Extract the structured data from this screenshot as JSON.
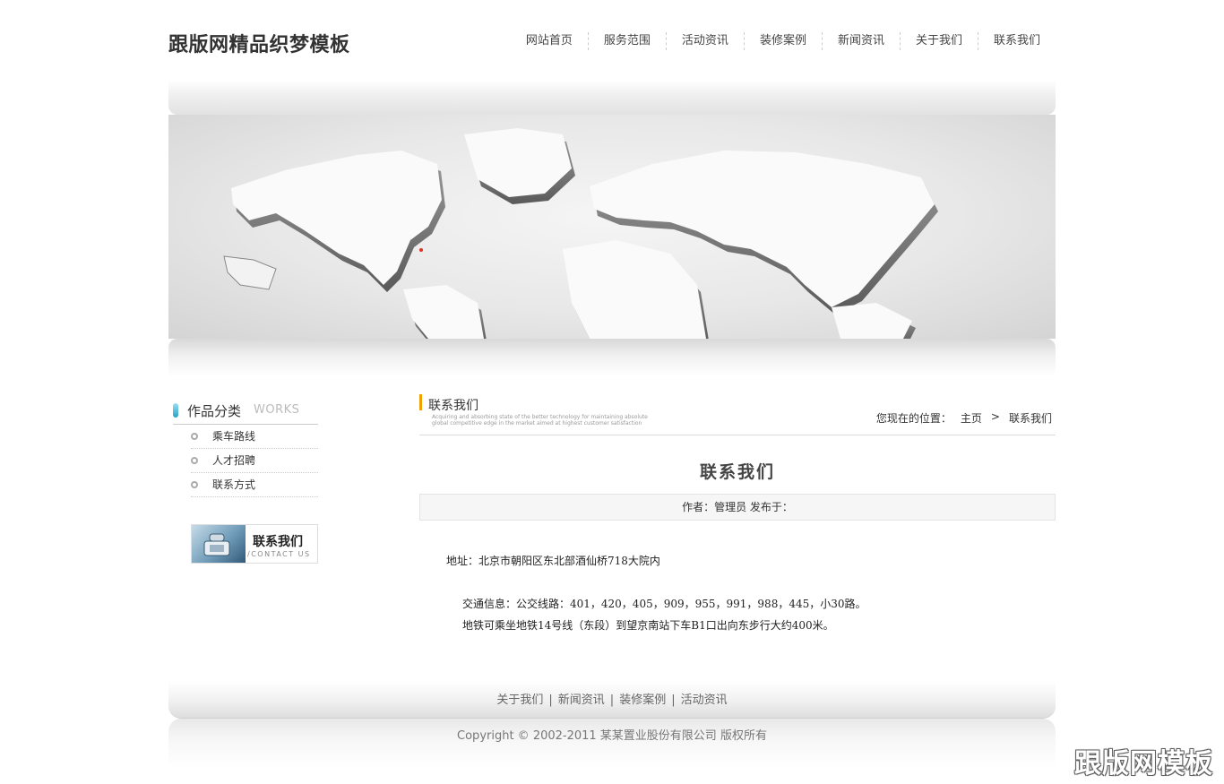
{
  "header": {
    "logo": "跟版网精品织梦模板",
    "nav": [
      "网站首页",
      "服务范围",
      "活动资讯",
      "装修案例",
      "新闻资讯",
      "关于我们",
      "联系我们"
    ]
  },
  "sidebar": {
    "title_cn": "作品分类",
    "title_en": "WORKS",
    "items": [
      "乘车路线",
      "人才招聘",
      "联系方式"
    ],
    "contact_banner": {
      "cn": "联系我们",
      "en": "/CONTACT US"
    }
  },
  "main": {
    "section_title": "联系我们",
    "section_sub": "Acquiring and absorbing state of the better technology for maintaining absolute global competitive edge in the market aimed at highest customer satisfaction",
    "breadcrumb": {
      "label": "您现在的位置：",
      "home": "主页",
      "arrow": ">",
      "current": "联系我们"
    },
    "article": {
      "title": "联系我们",
      "meta": "作者：管理员   发布于：",
      "address": "地址：北京市朝阳区东北部酒仙桥718大院内",
      "traffic": "交通信息：公交线路：401，420，405，909，955，991，988，445，小30路。",
      "subway": "地铁可乘坐地铁14号线（东段）到望京南站下车B1口出向东步行大约400米。"
    }
  },
  "footer": {
    "links": [
      "关于我们",
      "新闻资讯",
      "装修案例",
      "活动资讯"
    ],
    "copyright": "Copyright © 2002-2011 某某置业股份有限公司 版权所有"
  },
  "watermark": "跟版网模板"
}
